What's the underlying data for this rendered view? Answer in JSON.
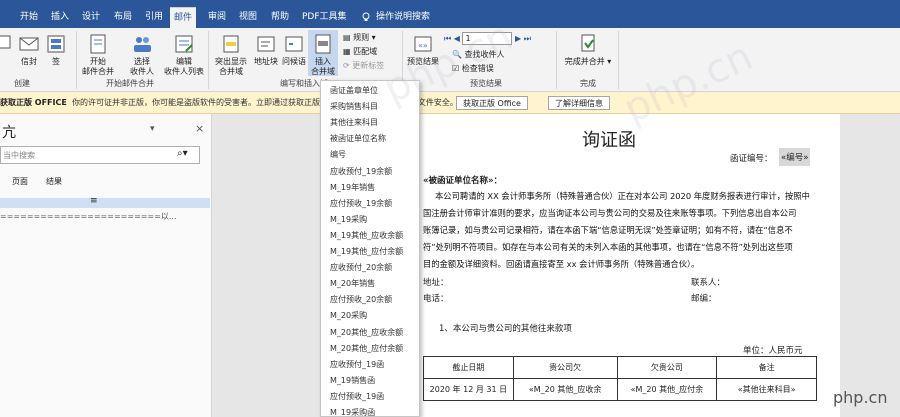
{
  "tabs": [
    "开始",
    "插入",
    "设计",
    "布局",
    "引用",
    "邮件",
    "审阅",
    "视图",
    "帮助",
    "PDF工具集",
    "操作说明搜索"
  ],
  "active_tab": "邮件",
  "ribbon": {
    "create": {
      "group": "创建",
      "items": [
        "中文信封",
        "信封",
        "标签"
      ]
    },
    "partial_visible": [
      "封",
      "签"
    ],
    "start_merge": {
      "group": "开始邮件合并",
      "start": "开始\n邮件合并",
      "select": "选择\n收件人",
      "edit": "编辑\n收件人列表"
    },
    "write_insert": {
      "group": "编写和插入域",
      "highlight": "突出显示\n合并域",
      "address": "地址块",
      "greeting": "问候语",
      "insert_field": "插入\n合并域",
      "rules": "规则",
      "match": "匹配域",
      "update": "更新标签"
    },
    "preview": {
      "group": "预览结果",
      "preview_btn": "预览结果",
      "record": "1",
      "find": "查找收件人",
      "check": "检查错误"
    },
    "finish": {
      "group": "完成",
      "finish_btn": "完成并合并"
    }
  },
  "infobar": {
    "title": "获取正版 OFFICE",
    "message": "你的许可证并非正版，你可能是盗版软件的受害者。立即通过获取正版 Office，以避免中断并确保文件安全。",
    "btn1": "获取正版 Office",
    "btn2": "了解详细信息"
  },
  "nav": {
    "title": "亢",
    "search_placeholder": "当中搜索",
    "tabs": [
      "页面",
      "结果"
    ],
    "close": "×",
    "result_line": "========================以..."
  },
  "dropdown": [
    "函证盖章单位",
    "采购销售科目",
    "其他往来科目",
    "被函证单位名称",
    "编号",
    "应收预付_19余额",
    "M_19年销售",
    "应付预收_19余额",
    "M_19采购",
    "M_19其他_应收余额",
    "M_19其他_应付余额",
    "应收预付_20余额",
    "M_20年销售",
    "应付预收_20余额",
    "M_20采购",
    "M_20其他_应收余额",
    "M_20其他_应付余额",
    "应收预付_19函",
    "M_19销售函",
    "应付预收_19函",
    "M_19采购函"
  ],
  "doc": {
    "title": "询证函",
    "number_label": "函证编号：",
    "number_field": "«编号»",
    "addressee": "«被函证单位名称»：",
    "body": [
      "本公司聘请的 XX 会计师事务所（特殊普通合伙）正在对本公司 2020 年度财务报表进行审计，按照中",
      "国注册会计师审计准则的要求，应当询证本公司与贵公司的交易及往来账等事项。下列信息出自本公司",
      "账簿记录，如与贵公司记录相符，请在本函下端“信息证明无误”处签章证明；如有不符，请在“信息不",
      "符”处列明不符项目。如存在与本公司有关的未列入本函的其他事项，也请在“信息不符”处列出这些项",
      "目的金额及详细资料。回函请直接寄至 xx 会计师事务所（特殊普通合伙）。"
    ],
    "address": "地址：",
    "contact": "联系人：",
    "phone": "电话：",
    "postcode": "邮编：",
    "section": "1、本公司与贵公司的其他往来款项",
    "unit": "单位：人民币元",
    "table_header": [
      "截止日期",
      "贵公司欠",
      "欠贵公司",
      "备注"
    ],
    "table_row": [
      "2020 年 12 月 31 日",
      "«M_20 其他_应收余",
      "«M_20 其他_应付余",
      "«其他往来科目»"
    ]
  },
  "watermark": "php.cn"
}
